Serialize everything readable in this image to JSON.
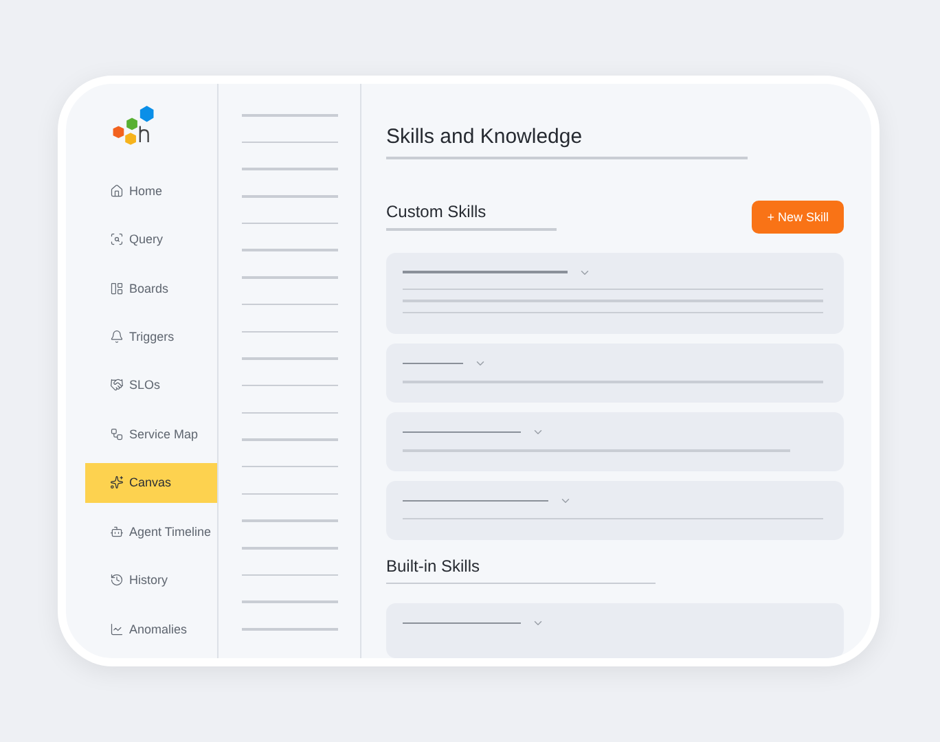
{
  "nav": [
    {
      "label": "Home",
      "selected": false
    },
    {
      "label": "Query",
      "selected": false
    },
    {
      "label": "Boards",
      "selected": false
    },
    {
      "label": "Triggers",
      "selected": false
    },
    {
      "label": "SLOs",
      "selected": false
    },
    {
      "label": "Service Map",
      "selected": false
    },
    {
      "label": "Canvas",
      "selected": true
    },
    {
      "label": "Agent Timeline",
      "selected": false
    },
    {
      "label": "History",
      "selected": false
    },
    {
      "label": "Anomalies",
      "selected": false
    }
  ],
  "page_title": "Skills and Knowledge",
  "custom_skills": {
    "title": "Custom Skills",
    "button": "+ New Skill"
  },
  "builtin_skills": {
    "title": "Built-in Skills"
  }
}
